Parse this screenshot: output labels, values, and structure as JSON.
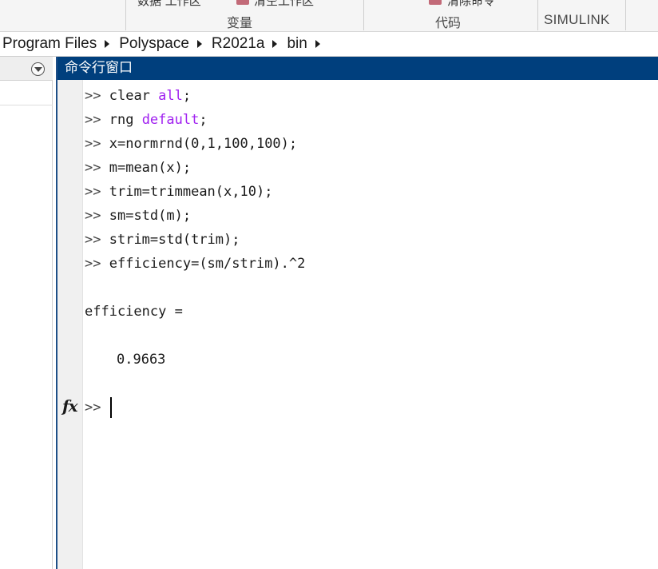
{
  "ribbon": {
    "clipped_left": "数据   工作区",
    "clipped_mid": "清空工作区",
    "clipped_right": "清除命令",
    "group_variable": "变量",
    "group_code": "代码",
    "group_simulink": "SIMULINK",
    "accent_color": "#c26a78"
  },
  "address_bar": {
    "segments": [
      "Program Files",
      "Polyspace",
      "R2021a",
      "bin"
    ]
  },
  "left_panel": {
    "dropdown_icon": "chevron-circle-down-icon"
  },
  "command_window": {
    "title": "命令行窗口",
    "title_bg": "#003f7d",
    "prompt": ">>",
    "keyword_color": "#a020f0",
    "commands": [
      {
        "pre": "clear ",
        "kw": "all",
        "post": ";"
      },
      {
        "pre": "rng ",
        "kw": "default",
        "post": ";"
      },
      {
        "pre": "x=normrnd(0,1,100,100);",
        "kw": "",
        "post": ""
      },
      {
        "pre": "m=mean(x);",
        "kw": "",
        "post": ""
      },
      {
        "pre": "trim=trimmean(x,10);",
        "kw": "",
        "post": ""
      },
      {
        "pre": "sm=std(m);",
        "kw": "",
        "post": ""
      },
      {
        "pre": "strim=std(trim);",
        "kw": "",
        "post": ""
      },
      {
        "pre": "efficiency=(sm/strim).^2",
        "kw": "",
        "post": ""
      }
    ],
    "output_label": "efficiency =",
    "output_value": "0.9663",
    "fx_label": "fx",
    "current_input": ""
  }
}
